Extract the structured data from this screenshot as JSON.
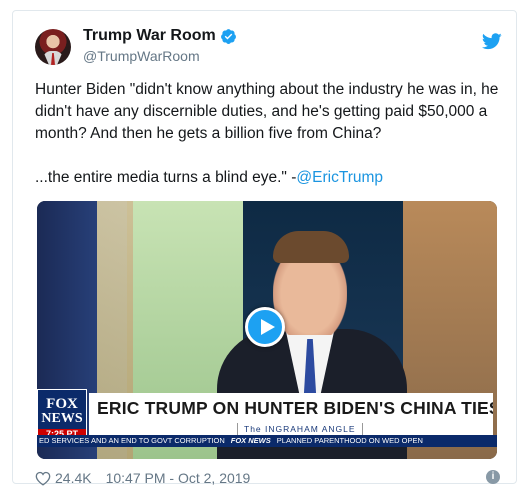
{
  "tweet": {
    "display_name": "Trump War Room",
    "handle": "@TrumpWarRoom",
    "text_p1": "Hunter Biden \"didn't know anything about the industry he was in, he didn't have any discernible duties, and he's getting paid $50,000 a month? And then he gets a billion five from China?",
    "text_p2_prefix": "...the entire media turns a blind eye.\" -",
    "mention": "@EricTrump",
    "likes": "24.4K",
    "timestamp": "10:47 PM - Oct 2, 2019"
  },
  "video": {
    "logo_line1": "FOX",
    "logo_line2": "NEWS",
    "logo_time": "7:25 PT",
    "headline": "ERIC TRUMP ON HUNTER BIDEN'S CHINA TIES",
    "show_name": "The INGRAHAM ANGLE",
    "ticker_left": "ED SERVICES AND AN END TO GOVT CORRUPTION",
    "ticker_brand": "FOX NEWS",
    "ticker_right": "PLANNED PARENTHOOD ON WED OPEN"
  },
  "colors": {
    "accent": "#1da1f2",
    "mention": "#1b95e0",
    "meta": "#657786",
    "fox_blue": "#0b2a6a"
  },
  "icons": {
    "verified": "verified-badge-icon",
    "brand": "twitter-bird-icon",
    "like": "heart-icon",
    "info": "info-icon",
    "play": "play-icon"
  }
}
